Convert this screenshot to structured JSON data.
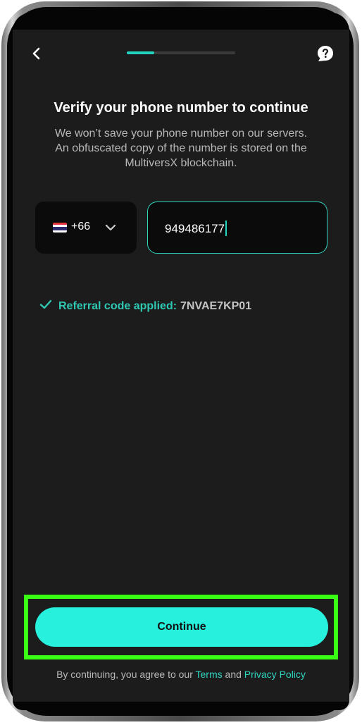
{
  "header": {
    "back_icon": "chevron-left-icon",
    "help_icon": "help-bubble-icon",
    "progress": 0.25,
    "accent_color": "#23d5c0"
  },
  "title": "Verify your phone number to continue",
  "subtitle": "We won’t save your phone number on our servers.\nAn obfuscated copy of the number is stored on the\nMultiversX blockchain.",
  "country": {
    "flag": "Thailand",
    "dial_code": "+66",
    "dropdown_icon": "chevron-down-icon"
  },
  "phone": {
    "value": "949486177"
  },
  "referral": {
    "label": "Referral code applied:",
    "code": "7NVAE7KP01",
    "icon": "check-icon"
  },
  "continue_button": {
    "label": "Continue",
    "color": "#27f0dc"
  },
  "legal": {
    "prefix": "By continuing, you agree to our ",
    "terms": "Terms",
    "and": " and ",
    "privacy": "Privacy Policy"
  }
}
